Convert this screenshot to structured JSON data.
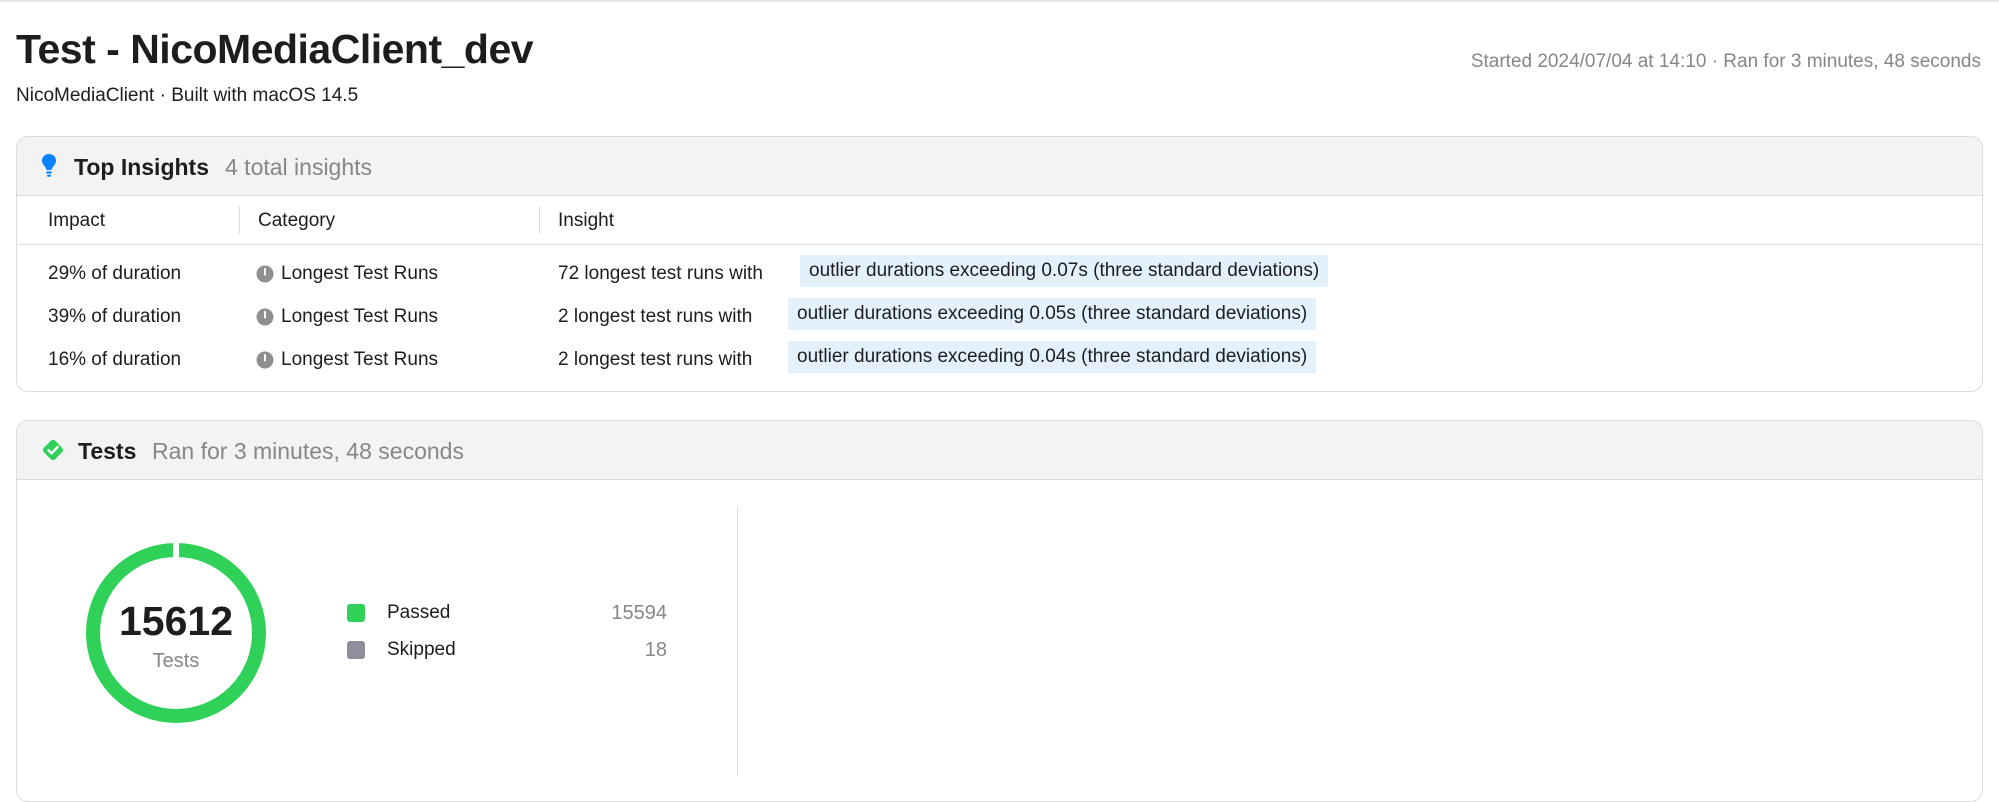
{
  "header": {
    "title": "Test - NicoMediaClient_dev",
    "subtitle": "NicoMediaClient · Built with macOS 14.5",
    "run_info": "Started 2024/07/04 at 14:10 · Ran for 3 minutes, 48 seconds"
  },
  "insights": {
    "icon": "lightbulb-icon",
    "title": "Top Insights",
    "meta": "4 total insights",
    "columns": [
      "Impact",
      "Category",
      "Insight"
    ],
    "rows": [
      {
        "impact": "29% of duration",
        "category_icon": "clock-icon",
        "category": "Longest Test Runs",
        "insight_prefix": "72 longest test runs with",
        "insight_highlight": "outlier durations exceeding 0.07s (three standard deviations)"
      },
      {
        "impact": "39% of duration",
        "category_icon": "clock-icon",
        "category": "Longest Test Runs",
        "insight_prefix": "2 longest test runs with",
        "insight_highlight": "outlier durations exceeding 0.05s (three standard deviations)"
      },
      {
        "impact": "16% of duration",
        "category_icon": "clock-icon",
        "category": "Longest Test Runs",
        "insight_prefix": "2 longest test runs with",
        "insight_highlight": "outlier durations exceeding 0.04s (three standard deviations)"
      }
    ]
  },
  "tests": {
    "icon": "checkmark-diamond-icon",
    "title": "Tests",
    "meta": "Ran for 3 minutes, 48 seconds",
    "total": "15612",
    "total_label": "Tests",
    "legend": [
      {
        "label": "Passed",
        "value": "15594",
        "color": "#30d158"
      },
      {
        "label": "Skipped",
        "value": "18",
        "color": "#8e8e9e"
      }
    ]
  },
  "colors": {
    "accent_blue": "#0a84ff",
    "passed_green": "#30d158",
    "highlight_bg": "#e3f1fd",
    "secondary_text": "#86868b"
  }
}
